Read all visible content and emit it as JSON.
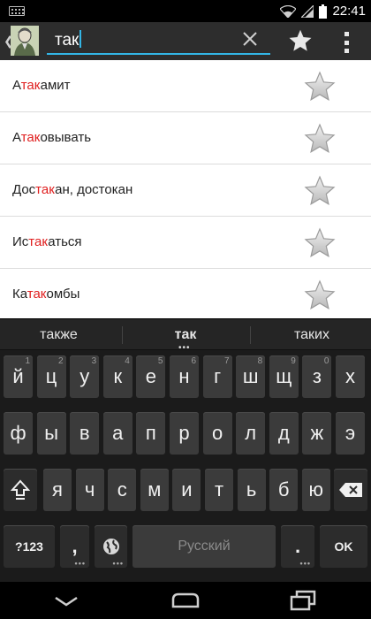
{
  "status_bar": {
    "time": "22:41"
  },
  "action_bar": {
    "search_value": "так"
  },
  "results": [
    {
      "pre": "А",
      "match": "так",
      "post": "амит"
    },
    {
      "pre": "А",
      "match": "так",
      "post": "овывать"
    },
    {
      "pre": "Дос",
      "match": "так",
      "post": "ан, достокан"
    },
    {
      "pre": "Ис",
      "match": "так",
      "post": "аться"
    },
    {
      "pre": "Ка",
      "match": "так",
      "post": "омбы"
    }
  ],
  "suggestions": {
    "left": "также",
    "center": "так",
    "right": "таких"
  },
  "keyboard": {
    "row1": [
      "й",
      "ц",
      "у",
      "к",
      "е",
      "н",
      "г",
      "ш",
      "щ",
      "з",
      "х"
    ],
    "row1_hints": [
      "1",
      "2",
      "3",
      "4",
      "5",
      "6",
      "7",
      "8",
      "9",
      "0",
      ""
    ],
    "row2": [
      "ф",
      "ы",
      "в",
      "а",
      "п",
      "р",
      "о",
      "л",
      "д",
      "ж",
      "э"
    ],
    "row3": [
      "я",
      "ч",
      "с",
      "м",
      "и",
      "т",
      "ь",
      "б",
      "ю"
    ],
    "symbols_label": "?123",
    "comma_label": ",",
    "space_label": "Русский",
    "period_label": ".",
    "ok_label": "OK"
  },
  "colors": {
    "accent": "#33b5e5",
    "highlight": "#e02020"
  }
}
